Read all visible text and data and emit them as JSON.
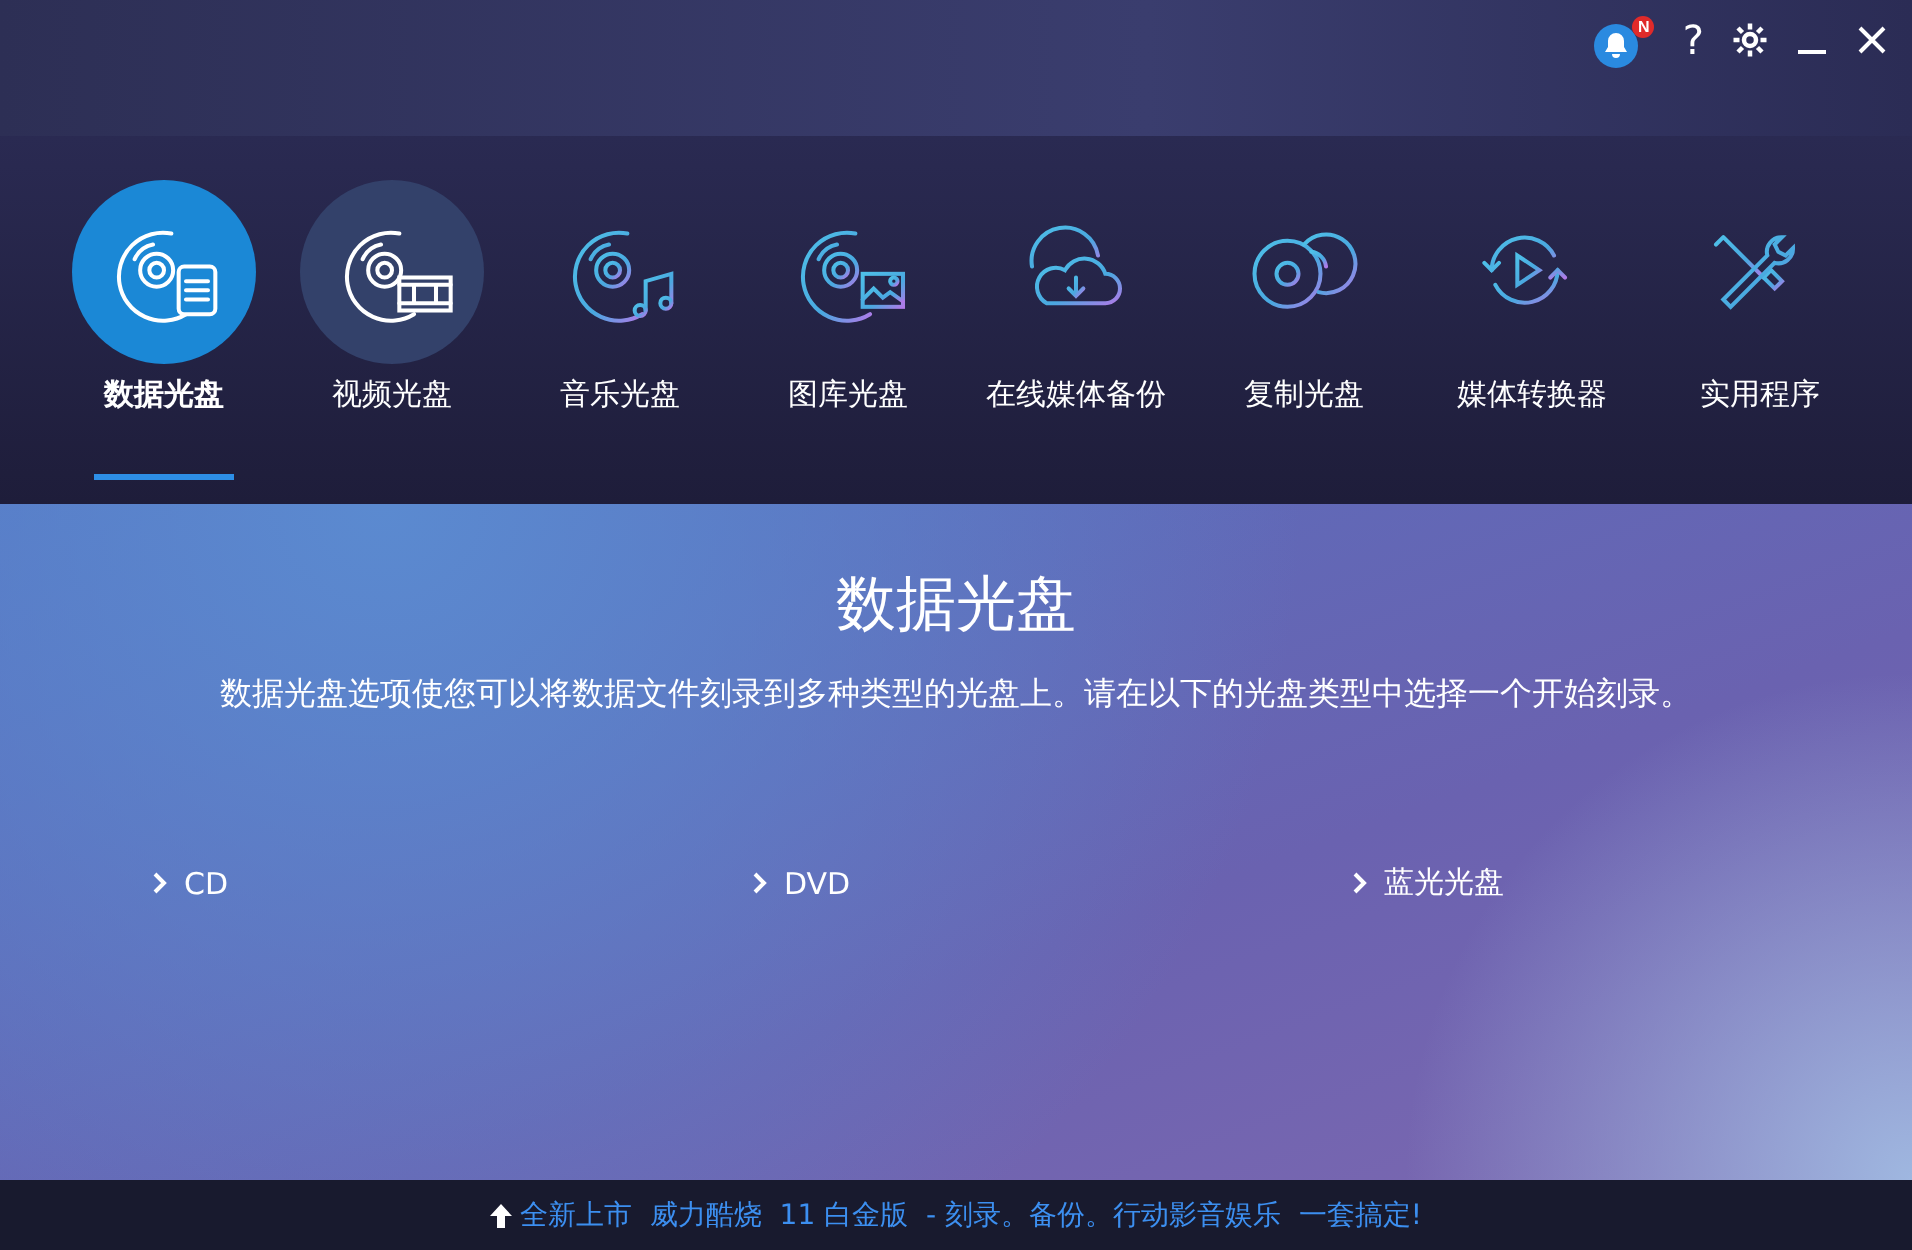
{
  "title_bar": {
    "notification_badge": "N",
    "help": "?"
  },
  "nav": [
    {
      "label": "数据光盘",
      "kind": "data",
      "selected": true,
      "hovered": false
    },
    {
      "label": "视频光盘",
      "kind": "video",
      "selected": false,
      "hovered": true
    },
    {
      "label": "音乐光盘",
      "kind": "music",
      "selected": false,
      "hovered": false
    },
    {
      "label": "图库光盘",
      "kind": "gallery",
      "selected": false,
      "hovered": false
    },
    {
      "label": "在线媒体备份",
      "kind": "cloud",
      "selected": false,
      "hovered": false
    },
    {
      "label": "复制光盘",
      "kind": "copy",
      "selected": false,
      "hovered": false
    },
    {
      "label": "媒体转换器",
      "kind": "convert",
      "selected": false,
      "hovered": false
    },
    {
      "label": "实用程序",
      "kind": "tools",
      "selected": false,
      "hovered": false
    }
  ],
  "content": {
    "heading": "数据光盘",
    "description": "数据光盘选项使您可以将数据文件刻录到多种类型的光盘上。请在以下的光盘类型中选择一个开始刻录。",
    "options": [
      "CD",
      "DVD",
      "蓝光光盘"
    ]
  },
  "footer": {
    "promo": "全新上市  威力酷烧  11 白金版  - 刻录。备份。行动影音娱乐  一套搞定!"
  }
}
